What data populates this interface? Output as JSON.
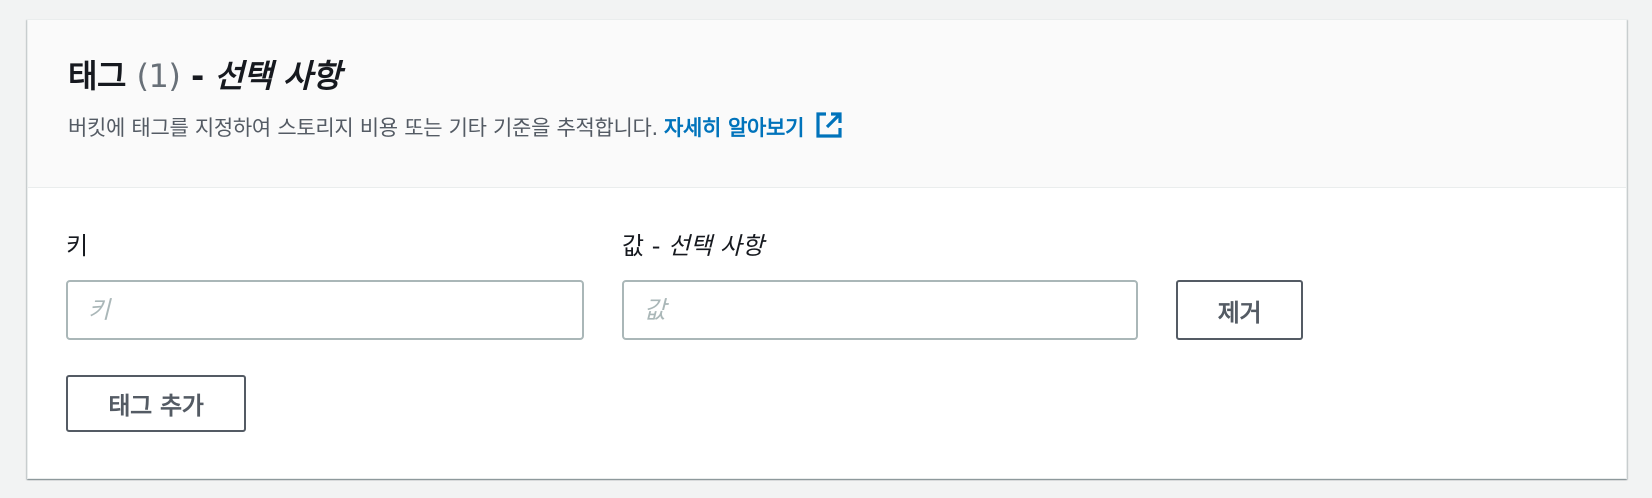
{
  "header": {
    "title_prefix": "태그 ",
    "title_count": "(1)",
    "title_sep": " - ",
    "title_optional": "선택 사항",
    "description": "버킷에 태그를 지정하여 스토리지 비용 또는 기타 기준을 추적합니다.",
    "learn_more_label": "자세히 알아보기",
    "link_color": "#0073bb"
  },
  "tag_row": {
    "key_label": "키",
    "key_placeholder": "키",
    "key_value": "",
    "value_label_prefix": "값 - ",
    "value_label_optional": "선택 사항",
    "value_placeholder": "값",
    "value_value": "",
    "remove_label": "제거"
  },
  "add_tag_label": "태그 추가"
}
